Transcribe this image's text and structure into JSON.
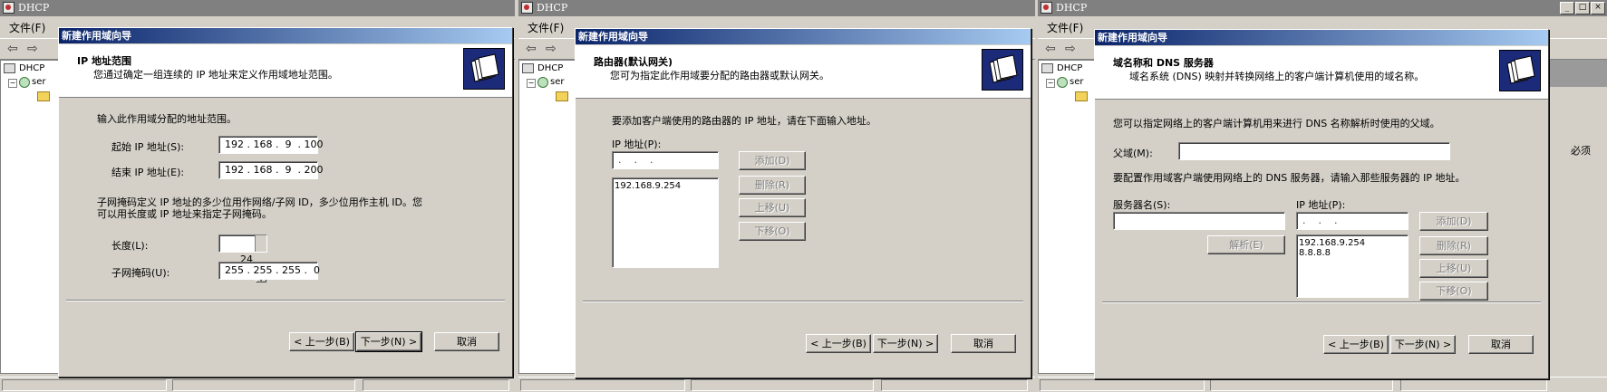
{
  "panels": [
    {
      "app_title": "DHCP",
      "menu_file": "文件(F)",
      "tree_root": "DHCP",
      "tree_server": "ser",
      "dialog": {
        "title": "新建作用域向导",
        "header_title": "IP 地址范围",
        "header_subtitle": "您通过确定一组连续的 IP 地址来定义作用域地址范围。",
        "intro": "输入此作用域分配的地址范围。",
        "start_ip_label": "起始 IP 地址(S):",
        "start_ip_value": "192 . 168 .  9  . 100",
        "end_ip_label": "结束 IP 地址(E):",
        "end_ip_value": "192 . 168 .  9  . 200",
        "mask_desc_1": "子网掩码定义 IP 地址的多少位用作网络/子网 ID，多少位用作主机 ID。您",
        "mask_desc_2": "可以用长度或 IP 地址来指定子网掩码。",
        "length_label": "长度(L):",
        "length_value": "24",
        "mask_label": "子网掩码(U):",
        "mask_value": "255 . 255 . 255 .  0",
        "back_button": "< 上一步(B)",
        "next_button": "下一步(N) >",
        "cancel_button": "取消"
      }
    },
    {
      "app_title": "DHCP",
      "menu_file": "文件(F)",
      "tree_root": "DHCP",
      "tree_server": "ser",
      "dialog": {
        "title": "新建作用域向导",
        "header_title": "路由器(默认网关)",
        "header_subtitle": "您可为指定此作用域要分配的路由器或默认网关。",
        "intro": "要添加客户端使用的路由器的 IP 地址，请在下面输入地址。",
        "ip_label": "IP 地址(P):",
        "ip_placeholder": ".    .    .",
        "router_list": [
          "192.168.9.254"
        ],
        "add_button": "添加(D)",
        "remove_button": "删除(R)",
        "up_button": "上移(U)",
        "down_button": "下移(O)",
        "back_button": "< 上一步(B)",
        "next_button": "下一步(N) >",
        "cancel_button": "取消"
      }
    },
    {
      "app_title": "DHCP",
      "menu_file": "文件(F)",
      "tree_root": "DHCP",
      "tree_server": "ser",
      "background_text_1": "必须",
      "dialog": {
        "title": "新建作用域向导",
        "header_title": "域名称和 DNS 服务器",
        "header_subtitle": "域名系统 (DNS) 映射并转换网络上的客户端计算机使用的域名称。",
        "intro": "您可以指定网络上的客户端计算机用来进行 DNS 名称解析时使用的父域。",
        "parent_domain_label": "父域(M):",
        "parent_domain_value": "",
        "dns_intro": "要配置作用域客户端使用网络上的 DNS 服务器，请输入那些服务器的 IP 地址。",
        "server_name_label": "服务器名(S):",
        "server_name_value": "",
        "ip_label": "IP 地址(P):",
        "ip_placeholder": ".    .    .",
        "resolve_button": "解析(E)",
        "dns_list": [
          "192.168.9.254",
          "8.8.8.8"
        ],
        "add_button": "添加(D)",
        "remove_button": "删除(R)",
        "up_button": "上移(U)",
        "down_button": "下移(O)",
        "back_button": "< 上一步(B)",
        "next_button": "下一步(N) >",
        "cancel_button": "取消"
      }
    }
  ]
}
